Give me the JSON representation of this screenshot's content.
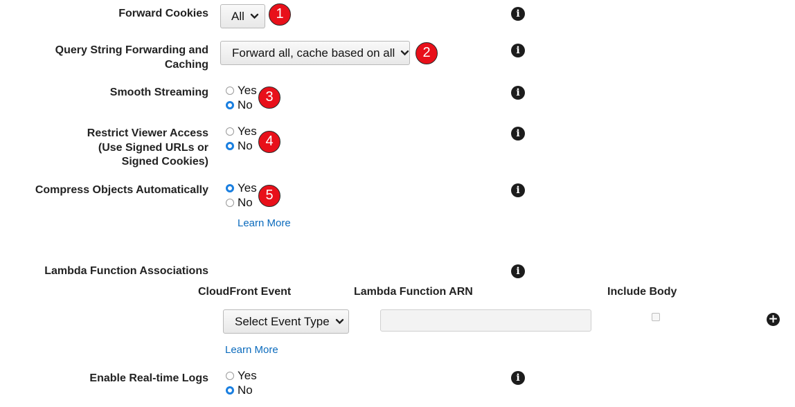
{
  "forward_cookies": {
    "label": "Forward Cookies",
    "value": "All",
    "badge": "1"
  },
  "query_string": {
    "label_line1": "Query String Forwarding and",
    "label_line2": "Caching",
    "value": "Forward all, cache based on all",
    "badge": "2"
  },
  "smooth_streaming": {
    "label": "Smooth Streaming",
    "options": [
      "Yes",
      "No"
    ],
    "selected": "No",
    "badge": "3"
  },
  "restrict_viewer": {
    "label_line1": "Restrict Viewer Access",
    "label_line2": "(Use Signed URLs or",
    "label_line3": "Signed Cookies)",
    "options": [
      "Yes",
      "No"
    ],
    "selected": "No",
    "badge": "4"
  },
  "compress_objects": {
    "label": "Compress Objects Automatically",
    "options": [
      "Yes",
      "No"
    ],
    "selected": "Yes",
    "badge": "5",
    "learn_more": "Learn More"
  },
  "lambda": {
    "label": "Lambda Function Associations",
    "col_event": "CloudFront Event",
    "col_arn": "Lambda Function ARN",
    "col_body": "Include Body",
    "event_select": "Select Event Type",
    "arn_value": "",
    "include_body": false,
    "learn_more": "Learn More"
  },
  "realtime_logs": {
    "label": "Enable Real-time Logs",
    "options": [
      "Yes",
      "No"
    ],
    "selected": "No"
  },
  "icons": {
    "info": "info-icon",
    "add": "plus-circle-icon",
    "dropdown": "chevron-down-icon"
  }
}
